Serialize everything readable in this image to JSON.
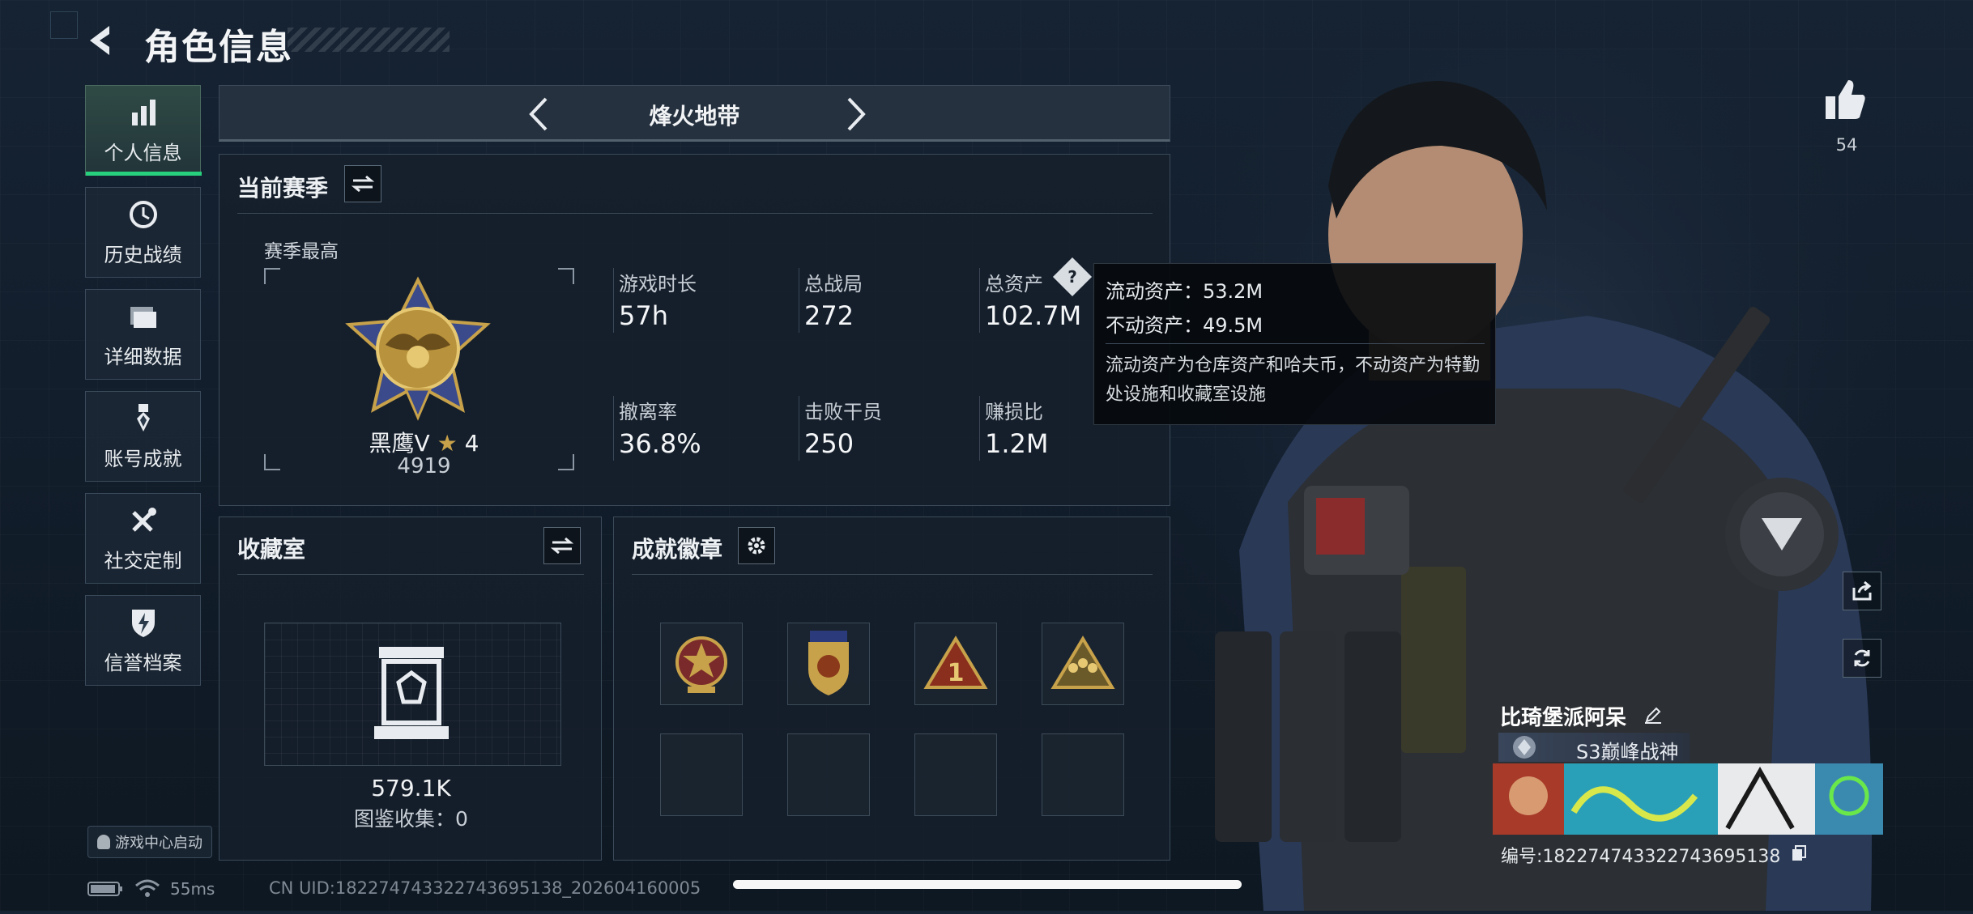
{
  "header": {
    "title": "角色信息"
  },
  "sidebar": {
    "items": [
      {
        "label": "个人信息",
        "icon": "bar-chart-icon",
        "active": true
      },
      {
        "label": "历史战绩",
        "icon": "history-clock-icon",
        "active": false
      },
      {
        "label": "详细数据",
        "icon": "folder-icon",
        "active": false
      },
      {
        "label": "账号成就",
        "icon": "medal-icon",
        "active": false
      },
      {
        "label": "社交定制",
        "icon": "wrench-tools-icon",
        "active": false
      },
      {
        "label": "信誉档案",
        "icon": "shield-bolt-icon",
        "active": false
      }
    ],
    "game_center": "游戏中心启动"
  },
  "mode": {
    "title": "烽火地带"
  },
  "season": {
    "title": "当前赛季",
    "best_label": "赛季最高",
    "rank_name": "黑鹰Ⅴ",
    "rank_stars": "4",
    "rank_score": "4919",
    "stats": [
      {
        "label": "游戏时长",
        "value": "57h"
      },
      {
        "label": "总战局",
        "value": "272"
      },
      {
        "label": "总资产",
        "value": "102.7M"
      },
      {
        "label": "撤离率",
        "value": "36.8%"
      },
      {
        "label": "击败干员",
        "value": "250"
      },
      {
        "label": "赚损比",
        "value": "1.2M"
      }
    ]
  },
  "tooltip": {
    "liquid": "流动资产：53.2M",
    "fixed": "不动资产：49.5M",
    "description": "流动资产为仓库资产和哈夫币，不动资产为特勤处设施和收藏室设施"
  },
  "collection": {
    "title": "收藏室",
    "value": "579.1K",
    "catalog": "图鉴收集：0"
  },
  "achievements": {
    "title": "成就徽章",
    "badges": [
      "star-medal-icon",
      "shield-medal-icon",
      "triangle-one-icon",
      "squad-triangle-icon"
    ]
  },
  "player": {
    "likes": "54",
    "name": "比琦堡派阿呆",
    "title": "S3巅峰战神",
    "id": "编号:18227474332274369513​8"
  },
  "status": {
    "ping": "55ms",
    "uid": "CN UID:18227474332274369513​8_202604160005"
  },
  "colors": {
    "accent": "#27d07c",
    "background": "#131e2b",
    "panel": "#16202c",
    "gold": "#c8a24a"
  }
}
